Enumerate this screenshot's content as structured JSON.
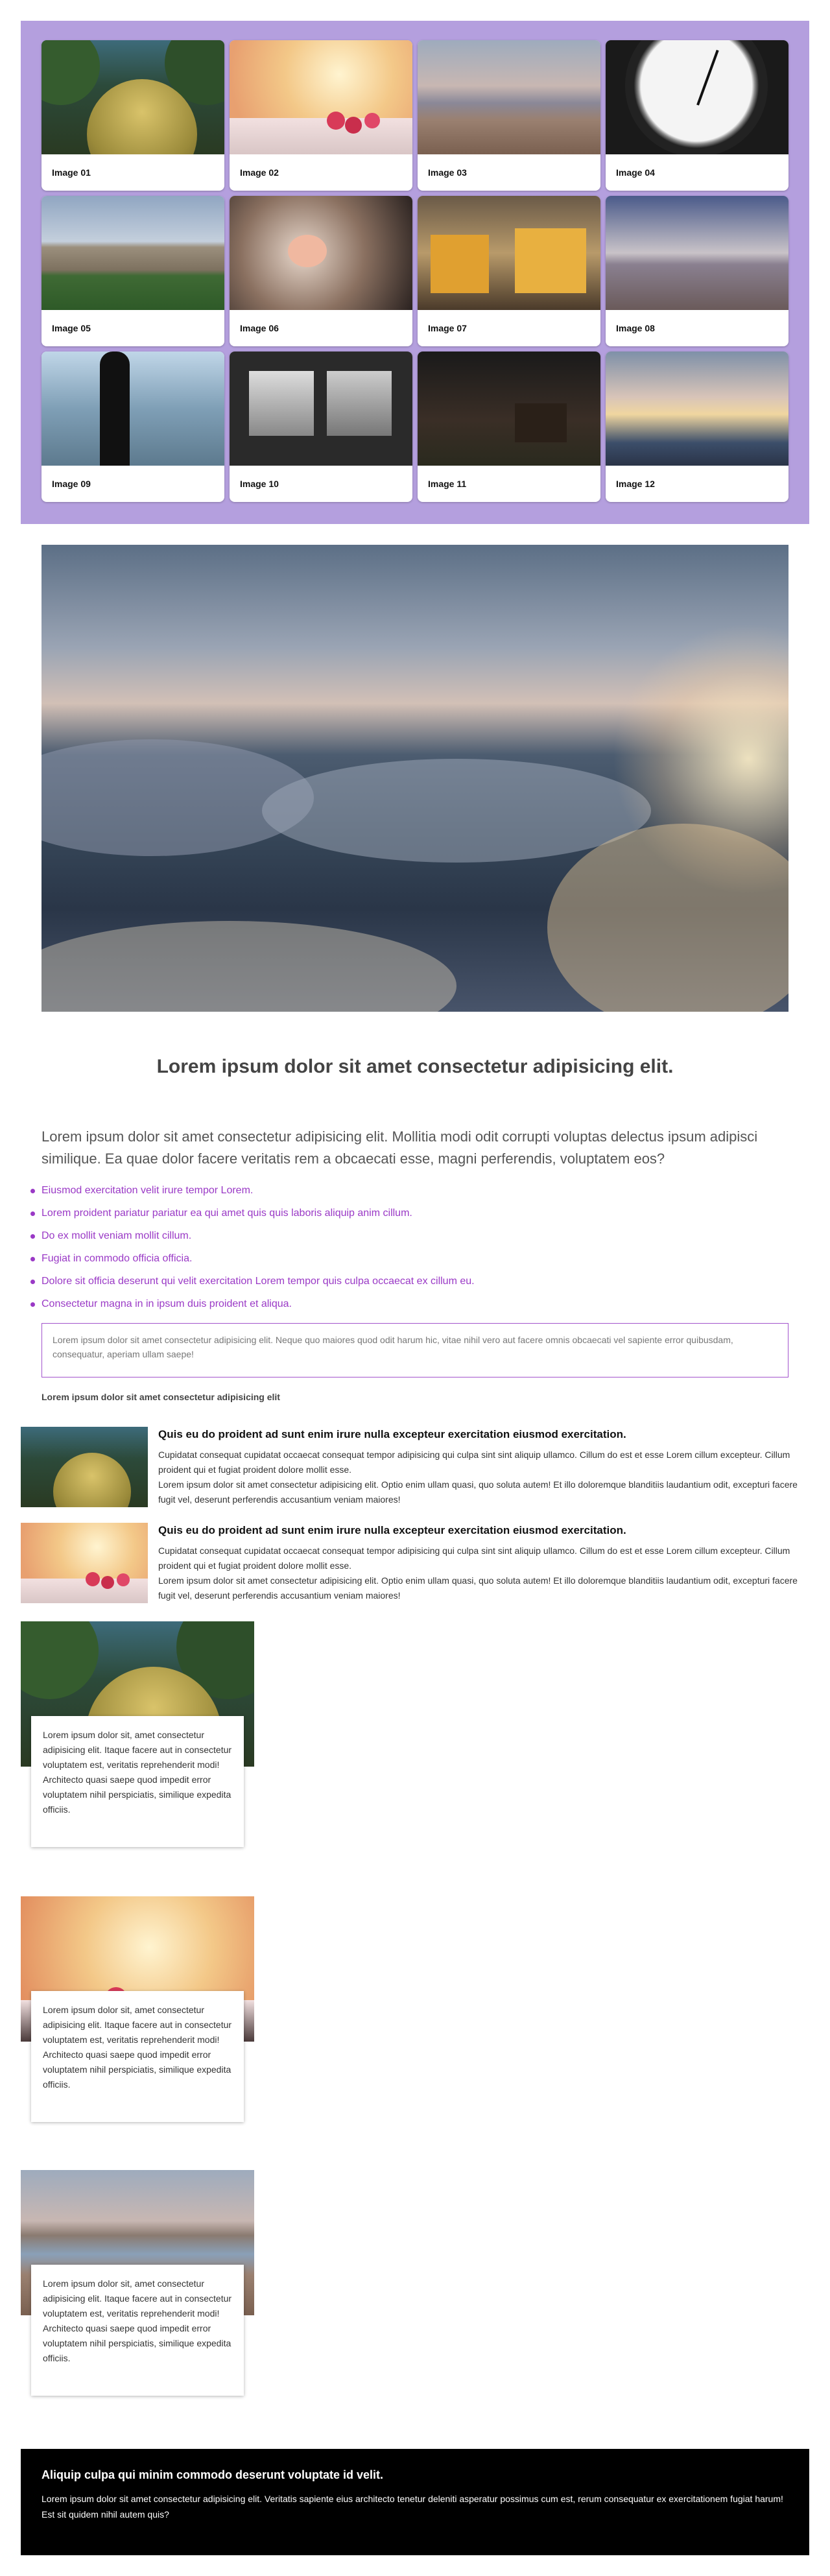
{
  "gallery": {
    "items": [
      {
        "label": "Image 01",
        "icon": "moss-hill-photo"
      },
      {
        "label": "Image 02",
        "icon": "berries-photo"
      },
      {
        "label": "Image 03",
        "icon": "lake-marsh-photo"
      },
      {
        "label": "Image 04",
        "icon": "clock-photo"
      },
      {
        "label": "Image 05",
        "icon": "college-building-photo"
      },
      {
        "label": "Image 06",
        "icon": "tea-flower-photo"
      },
      {
        "label": "Image 07",
        "icon": "tram-photo"
      },
      {
        "label": "Image 08",
        "icon": "beach-photo"
      },
      {
        "label": "Image 09",
        "icon": "person-lake-photo"
      },
      {
        "label": "Image 10",
        "icon": "train-window-photo"
      },
      {
        "label": "Image 11",
        "icon": "barn-night-photo"
      },
      {
        "label": "Image 12",
        "icon": "clouds-sunset-photo"
      }
    ],
    "background": "#b49fde"
  },
  "hero": {
    "icon": "clouds-above-photo"
  },
  "article": {
    "title": "Lorem ipsum dolor sit amet consectetur adipisicing elit.",
    "lead": "Lorem ipsum dolor sit amet consectetur adipisicing elit. Mollitia modi odit corrupti voluptas delectus ipsum adipisci similique. Ea quae dolor facere veritatis rem a obcaecati esse, magni perferendis, voluptatem eos?",
    "list": [
      "Eiusmod exercitation velit irure tempor Lorem.",
      "Lorem proident pariatur pariatur ea qui amet quis quis laboris aliquip anim cillum.",
      "Do ex mollit veniam mollit cillum.",
      "Fugiat in commodo officia officia.",
      "Dolore sit officia deserunt qui velit exercitation Lorem tempor quis culpa occaecat ex cillum eu.",
      "Consectetur magna in in ipsum duis proident et aliqua."
    ],
    "quote": "Lorem ipsum dolor sit amet consectetur adipisicing elit. Neque quo maiores quod odit harum hic, vitae nihil vero aut facere omnis obcaecati vel sapiente error quibusdam, consequatur, aperiam ullam saepe!",
    "small_bold": "Lorem ipsum dolor sit amet consectetur adipisicing elit",
    "accent": "#9a39c6"
  },
  "media": [
    {
      "heading": "Quis eu do proident ad sunt enim irure nulla excepteur exercitation eiusmod exercitation.",
      "p1": "Cupidatat consequat cupidatat occaecat consequat tempor adipisicing qui culpa sint sint aliquip ullamco. Cillum do est et esse Lorem cillum excepteur. Cillum proident qui et fugiat proident dolore mollit esse.",
      "p2": "Lorem ipsum dolor sit amet consectetur adipisicing elit. Optio enim ullam quasi, quo soluta autem! Et illo doloremque blanditiis laudantium odit, excepturi facere fugit vel, deserunt perferendis accusantium veniam maiores!"
    },
    {
      "heading": "Quis eu do proident ad sunt enim irure nulla excepteur exercitation eiusmod exercitation.",
      "p1": "Cupidatat consequat cupidatat occaecat consequat tempor adipisicing qui culpa sint sint aliquip ullamco. Cillum do est et esse Lorem cillum excepteur. Cillum proident qui et fugiat proident dolore mollit esse.",
      "p2": "Lorem ipsum dolor sit amet consectetur adipisicing elit. Optio enim ullam quasi, quo soluta autem! Et illo doloremque blanditiis laudantium odit, excepturi facere fugit vel, deserunt perferendis accusantium veniam maiores!"
    }
  ],
  "overlap": [
    {
      "text": "Lorem ipsum dolor sit, amet consectetur adipisicing elit. Itaque facere aut in consectetur voluptatem est, veritatis reprehenderit modi! Architecto quasi saepe quod impedit error voluptatem nihil perspiciatis, similique expedita officiis."
    },
    {
      "text": "Lorem ipsum dolor sit, amet consectetur adipisicing elit. Itaque facere aut in consectetur voluptatem est, veritatis reprehenderit modi! Architecto quasi saepe quod impedit error voluptatem nihil perspiciatis, similique expedita officiis."
    },
    {
      "text": "Lorem ipsum dolor sit, amet consectetur adipisicing elit. Itaque facere aut in consectetur voluptatem est, veritatis reprehenderit modi! Architecto quasi saepe quod impedit error voluptatem nihil perspiciatis, similique expedita officiis."
    }
  ],
  "footer": {
    "heading": "Aliquip culpa qui minim commodo deserunt voluptate id velit.",
    "text": "Lorem ipsum dolor sit amet consectetur adipisicing elit. Veritatis sapiente eius architecto tenetur deleniti asperatur possimus cum est, rerum consequatur ex exercitationem fugiat harum! Est sit quidem nihil autem quis?"
  }
}
